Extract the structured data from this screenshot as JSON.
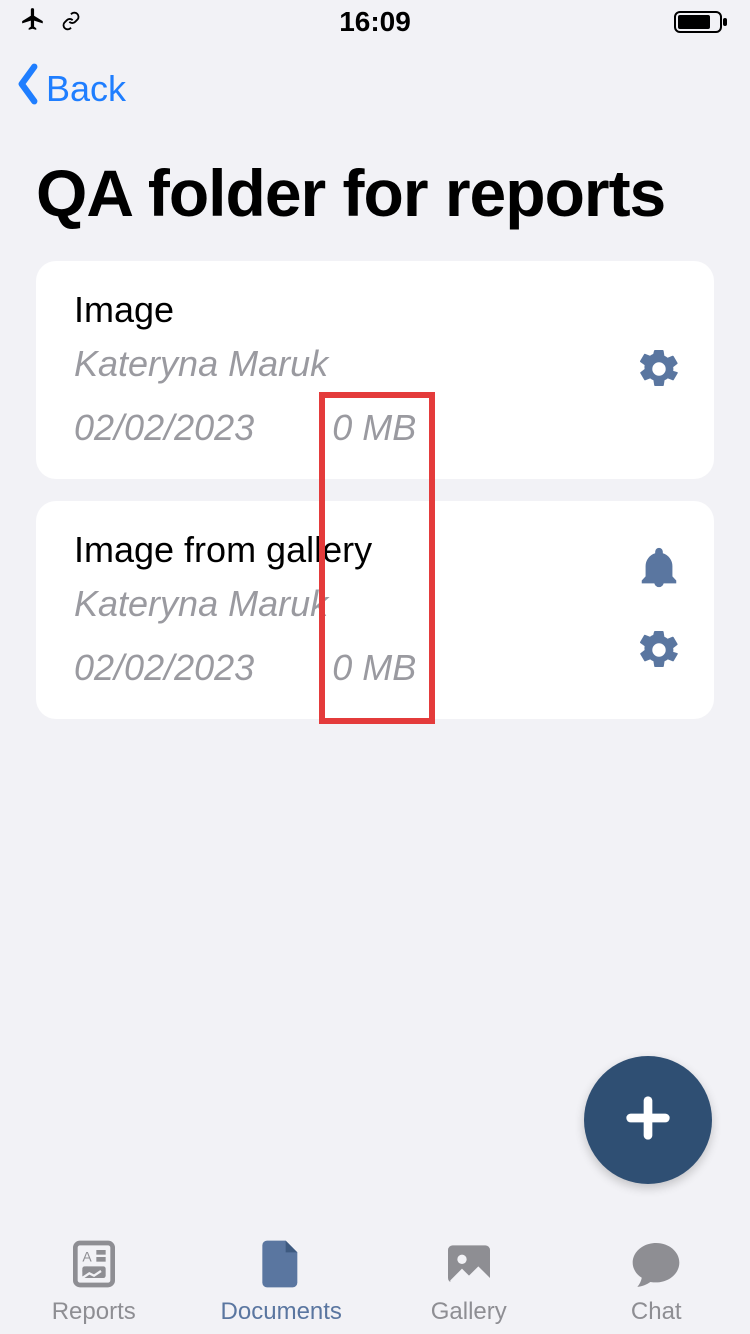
{
  "status_bar": {
    "time": "16:09"
  },
  "nav": {
    "back_label": "Back"
  },
  "page": {
    "title": "QA  folder for reports"
  },
  "items": [
    {
      "title": "Image",
      "author": "Kateryna Maruk",
      "date": "02/02/2023",
      "size": "0 MB",
      "has_bell": false
    },
    {
      "title": "Image from gallery",
      "author": "Kateryna Maruk",
      "date": "02/02/2023",
      "size": "0 MB",
      "has_bell": true
    }
  ],
  "tabs": [
    {
      "label": "Reports",
      "active": false
    },
    {
      "label": "Documents",
      "active": true
    },
    {
      "label": "Gallery",
      "active": false
    },
    {
      "label": "Chat",
      "active": false
    }
  ],
  "colors": {
    "accent_blue": "#1f7eff",
    "icon_blue": "#5a76a0",
    "fab_bg": "#2f4f73",
    "muted": "#9a9aa0",
    "annotation": "#e43b3b"
  }
}
